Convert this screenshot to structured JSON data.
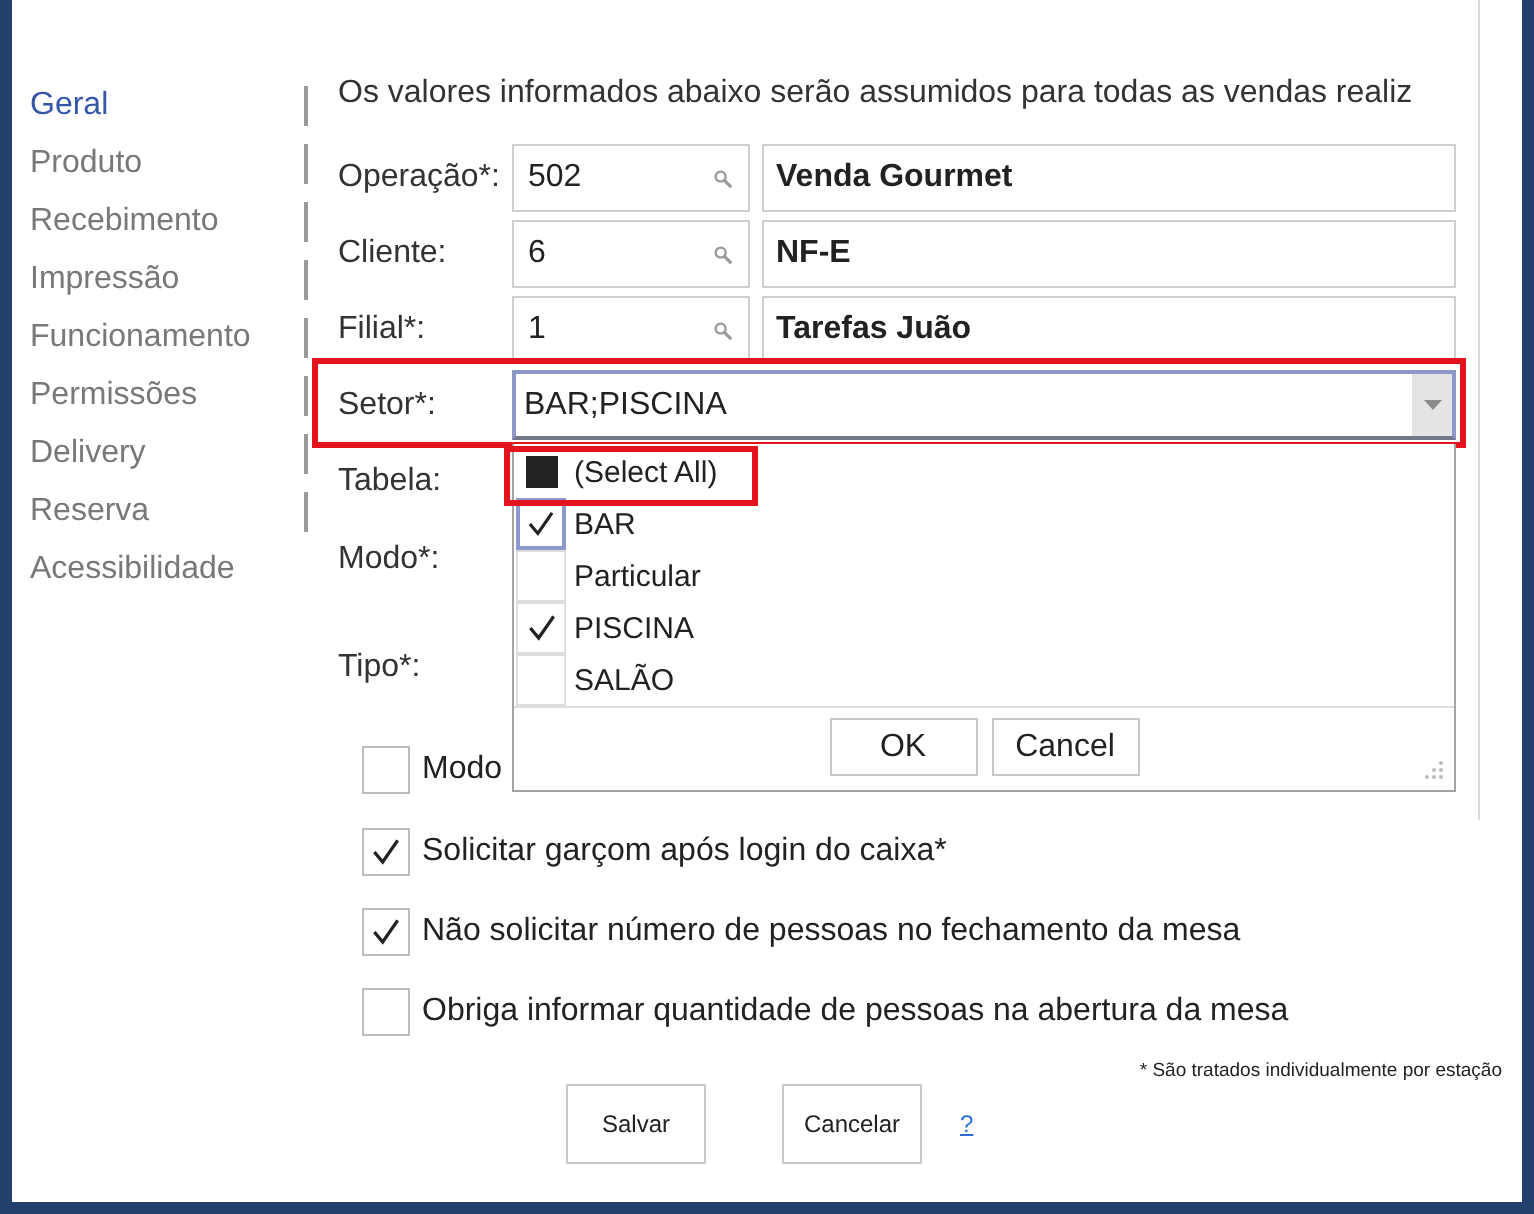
{
  "sidebar": {
    "items": [
      {
        "label": "Geral",
        "selected": true
      },
      {
        "label": "Produto",
        "selected": false
      },
      {
        "label": "Recebimento",
        "selected": false
      },
      {
        "label": "Impressão",
        "selected": false
      },
      {
        "label": "Funcionamento",
        "selected": false
      },
      {
        "label": "Permissões",
        "selected": false
      },
      {
        "label": "Delivery",
        "selected": false
      },
      {
        "label": "Reserva",
        "selected": false
      },
      {
        "label": "Acessibilidade",
        "selected": false
      }
    ]
  },
  "intro": "Os valores informados abaixo serão assumidos para todas as vendas realiz",
  "form": {
    "lookups": [
      {
        "label": "Operação*:",
        "code": "502",
        "description": "Venda Gourmet"
      },
      {
        "label": "Cliente:",
        "code": "6",
        "description": "NF-E"
      },
      {
        "label": "Filial*:",
        "code": "1",
        "description": "Tarefas Juão"
      }
    ],
    "setor": {
      "label": "Setor*:",
      "value": "BAR;PISCINA",
      "expanded": true,
      "highlighted": true
    },
    "covered_fields": [
      {
        "label": "Tabela:"
      },
      {
        "label": "Modo*:"
      },
      {
        "label": "Tipo*:"
      }
    ]
  },
  "dropdown": {
    "select_all": {
      "label": "(Select All)",
      "indeterminate": true,
      "highlighted": true
    },
    "options": [
      {
        "label": "BAR",
        "checked": true,
        "focused": true
      },
      {
        "label": "Particular",
        "checked": false,
        "focused": false
      },
      {
        "label": "PISCINA",
        "checked": true,
        "focused": false
      },
      {
        "label": "SALÃO",
        "checked": false,
        "focused": false
      }
    ],
    "buttons": [
      "OK",
      "Cancel"
    ]
  },
  "checkboxes": [
    {
      "label": "Modo",
      "checked": false
    },
    {
      "label": "Solicitar garçom após login do caixa*",
      "checked": true
    },
    {
      "label": "Não solicitar número de pessoas no fechamento da mesa",
      "checked": true
    },
    {
      "label": "Obriga informar quantidade de pessoas na abertura da mesa",
      "checked": false
    }
  ],
  "footnote": "* São tratados individualmente por estação",
  "buttons": [
    "Salvar",
    "Cancelar"
  ],
  "help_link": "?"
}
